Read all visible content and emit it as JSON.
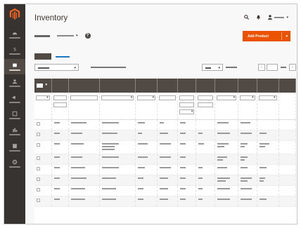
{
  "header": {
    "title": "Inventory",
    "search_icon": "search-icon",
    "notifications_icon": "bell-icon",
    "user_icon": "user-icon"
  },
  "store_view": {
    "select_caret": "▾"
  },
  "add_product": {
    "label": "Add Product",
    "caret": "▾"
  },
  "colors": {
    "sidebar": "#373330",
    "accent": "#eb5202",
    "header_dark": "#514943",
    "link": "#1979c3"
  },
  "sidebar": {
    "items": [
      {
        "icon": "dashboard-icon"
      },
      {
        "icon": "sales-icon"
      },
      {
        "icon": "catalog-icon"
      },
      {
        "icon": "customers-icon"
      },
      {
        "icon": "marketing-icon"
      },
      {
        "icon": "content-icon"
      },
      {
        "icon": "reports-icon"
      },
      {
        "icon": "stores-icon"
      },
      {
        "icon": "system-icon"
      }
    ]
  },
  "pager": {
    "prev": "‹",
    "next": "›"
  },
  "table": {
    "row_count": 8
  }
}
